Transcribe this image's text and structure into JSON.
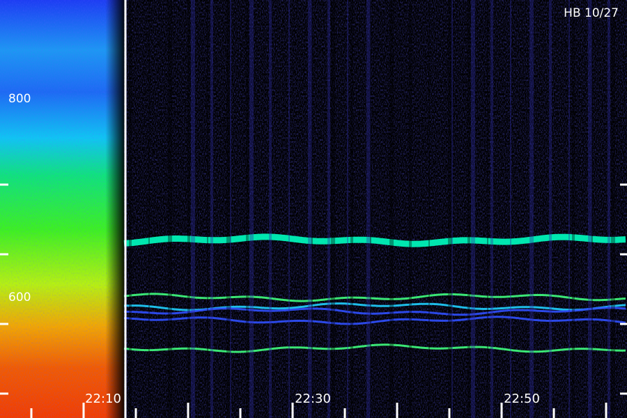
{
  "chart_data": {
    "type": "heatmap",
    "title": "HB 10/27",
    "x_tick_labels": [
      "22:10",
      "22:30",
      "22:50"
    ],
    "y_tick_labels": [
      "800",
      "600"
    ],
    "y_ticks": [
      800,
      700,
      600,
      500
    ],
    "ylim": [
      465,
      1065
    ],
    "x_tick_values_min": [
      10,
      30,
      50
    ],
    "xlim_min": [
      2.0,
      62.0
    ],
    "grid": false,
    "marker_line_min": 14.0,
    "bright_bands": [
      {
        "y": 720,
        "level": 0.72
      },
      {
        "y": 638,
        "level": 0.62
      },
      {
        "y": 625,
        "level": 0.48
      },
      {
        "y": 618,
        "level": 0.45
      },
      {
        "y": 605,
        "level": 0.45
      },
      {
        "y": 565,
        "level": 0.62
      }
    ],
    "colors": {
      "background": "#000000",
      "low": "#1a0a6b",
      "mid": "#2a3cff",
      "cyan": "#00e0ff",
      "green": "#20ff40",
      "yellow": "#f0ff00",
      "orange": "#ff8000",
      "red": "#ff2000",
      "text": "#ffffff"
    }
  }
}
